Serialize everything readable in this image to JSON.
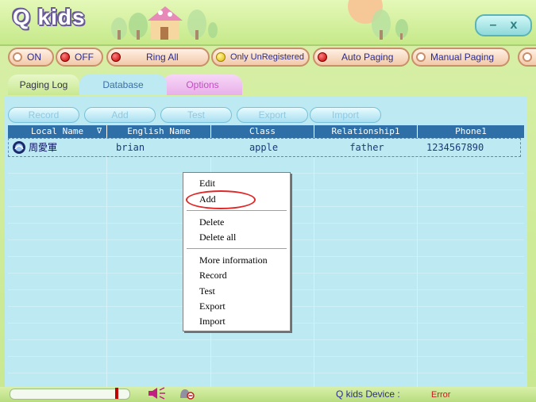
{
  "window": {
    "app_title": "Q kids",
    "controls": {
      "minimize": "–",
      "close": "x"
    }
  },
  "toolbar": {
    "buttons": [
      {
        "label": "ON",
        "dot": "white"
      },
      {
        "label": "OFF",
        "dot": "red"
      },
      {
        "label": "Ring All",
        "dot": "red"
      },
      {
        "label": "Only UnRegistered",
        "dot": "yellow"
      },
      {
        "label": "Auto Paging",
        "dot": "red"
      },
      {
        "label": "Manual Paging",
        "dot": "white"
      }
    ]
  },
  "tabs": {
    "paging_log": "Paging Log",
    "database": "Database",
    "options": "Options",
    "active": "Database"
  },
  "actions": {
    "record": "Record",
    "add": "Add",
    "test": "Test",
    "export": "Export",
    "import": "Import"
  },
  "table": {
    "sort_indicator": "∇",
    "headers": [
      "Local Name",
      "English Name",
      "Class",
      "Relationship1",
      "Phone1"
    ],
    "rows": [
      {
        "local_name": "周愛軍",
        "english_name": "brian",
        "class": "apple",
        "relationship": "father",
        "phone": "1234567890"
      }
    ]
  },
  "context_menu": {
    "items": [
      "Edit",
      "Add",
      "Delete",
      "Delete all",
      "More information",
      "Record",
      "Test",
      "Export",
      "Import"
    ],
    "highlighted": "Add"
  },
  "status_bar": {
    "device_label": "Q kids Device :",
    "device_status": "Error"
  },
  "colors": {
    "header_bg": "#2f6fa8",
    "content_bg": "#bde9f2",
    "error": "#c02020",
    "highlight_ring": "#e02828"
  },
  "icons": [
    "speaker-icon",
    "headset-icon",
    "bell-icon",
    "window-minimize-icon",
    "window-close-icon"
  ]
}
